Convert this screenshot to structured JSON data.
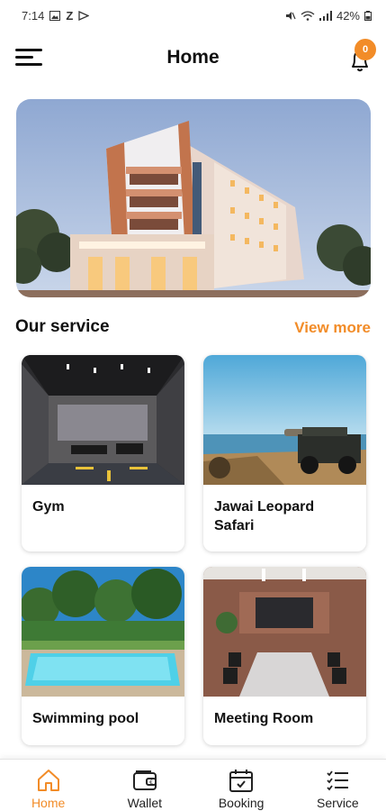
{
  "status_bar": {
    "time": "7:14",
    "left_icons": [
      "gallery-icon",
      "z-icon",
      "play-icon"
    ],
    "right_icons": [
      "mute-icon",
      "wifi-icon",
      "signal-icon"
    ],
    "battery": "42%"
  },
  "header": {
    "title": "Home",
    "notification_count": "0",
    "menu_icon": "menu-icon",
    "bell_icon": "bell-icon"
  },
  "hero": {
    "image": "hotel-building"
  },
  "services": {
    "title": "Our service",
    "view_more": "View more",
    "items": [
      {
        "label": "Gym",
        "image": "gym"
      },
      {
        "label": "Jawai Leopard Safari",
        "image": "safari"
      },
      {
        "label": "Swimming pool",
        "image": "pool"
      },
      {
        "label": "Meeting Room",
        "image": "meeting-room"
      }
    ]
  },
  "bottom_nav": {
    "items": [
      {
        "label": "Home",
        "icon": "home-icon",
        "active": true
      },
      {
        "label": "Wallet",
        "icon": "wallet-icon",
        "active": false
      },
      {
        "label": "Booking",
        "icon": "calendar-icon",
        "active": false
      },
      {
        "label": "Service",
        "icon": "checklist-icon",
        "active": false
      }
    ]
  },
  "colors": {
    "accent": "#f28c28",
    "text": "#111111",
    "background": "#ffffff"
  }
}
